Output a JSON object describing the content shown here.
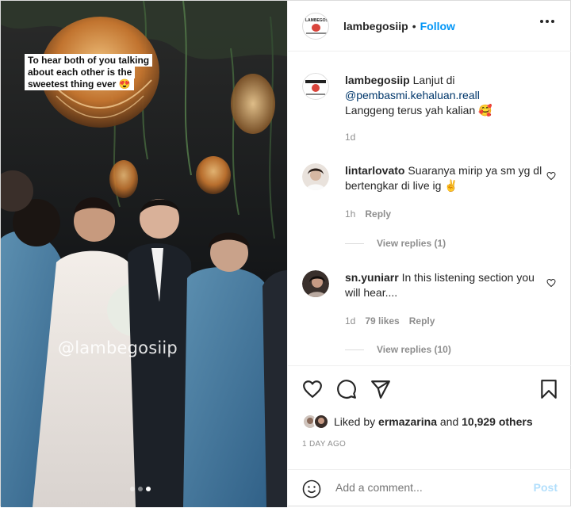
{
  "photo": {
    "caption_sticker": "To hear both of you talking about each other is the sweetest thing ever 😍",
    "watermark": "@lambegosiip",
    "carousel": {
      "total": 3,
      "active": 3
    }
  },
  "header": {
    "username": "lambegosiip",
    "separator": "•",
    "follow_label": "Follow",
    "avatar_logo_text": "LAMBEGOSIIP",
    "more_icon": "more-horizontal-icon"
  },
  "caption": {
    "username": "lambegosiip",
    "text_prefix": "Lanjut di",
    "mention": "@pembasmi.kehaluan.reall",
    "text_suffix": "Langgeng terus yah kalian 🥰",
    "time": "1d"
  },
  "comments": [
    {
      "username": "lintarlovato",
      "text": "Suaranya mirip ya sm yg dl bertengkar di live ig ✌️",
      "time": "1h",
      "likes": "",
      "reply_label": "Reply",
      "view_replies": "View replies (1)"
    },
    {
      "username": "sn.yuniarr",
      "text": "In this listening section you will hear....",
      "time": "1d",
      "likes": "79 likes",
      "reply_label": "Reply",
      "view_replies": "View replies (10)"
    }
  ],
  "actions": {
    "like_icon": "heart-icon",
    "comment_icon": "comment-icon",
    "share_icon": "send-icon",
    "save_icon": "bookmark-icon"
  },
  "likes": {
    "prefix": "Liked by",
    "user": "ermazarina",
    "middle": "and",
    "count": "10,929 others"
  },
  "date": "1 DAY AGO",
  "add_comment": {
    "placeholder": "Add a comment...",
    "post_label": "Post"
  },
  "colors": {
    "follow_blue": "#0095f6",
    "mention_link": "#00376b",
    "muted_text": "#8e8e8e",
    "post_disabled": "#b2dffc",
    "border": "#dbdbdb"
  }
}
